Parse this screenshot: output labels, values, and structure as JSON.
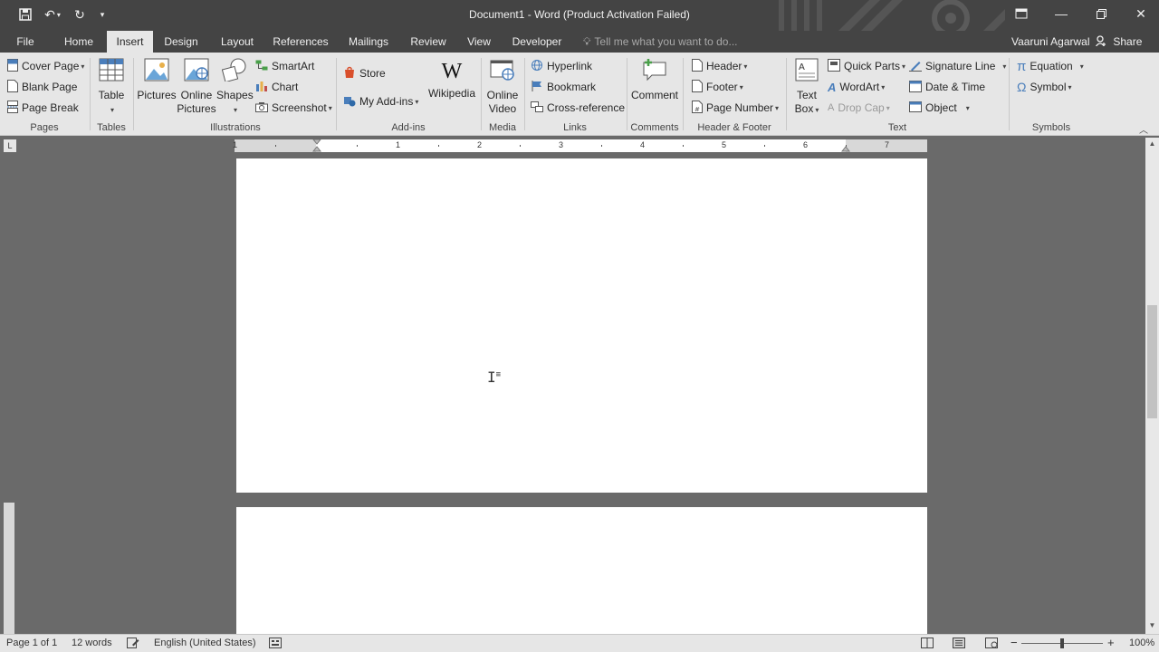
{
  "window": {
    "title": "Document1 - Word (Product Activation Failed)",
    "controls": [
      "ribbon-display-icon",
      "minimize-icon",
      "restore-icon",
      "close-icon"
    ]
  },
  "quick_access": {
    "icons": [
      "save-icon",
      "undo-icon",
      "redo-icon",
      "customize-icon"
    ]
  },
  "tabs": [
    {
      "label": "File"
    },
    {
      "label": "Home"
    },
    {
      "label": "Insert",
      "active": true
    },
    {
      "label": "Design"
    },
    {
      "label": "Layout"
    },
    {
      "label": "References"
    },
    {
      "label": "Mailings"
    },
    {
      "label": "Review"
    },
    {
      "label": "View"
    },
    {
      "label": "Developer"
    }
  ],
  "tell_me": "Tell me what you want to do...",
  "user": "Vaaruni Agarwal",
  "share": "Share",
  "ribbon": {
    "pages": {
      "label": "Pages",
      "items": [
        "Cover Page",
        "Blank Page",
        "Page Break"
      ]
    },
    "tables": {
      "label": "Tables",
      "table": "Table"
    },
    "illustrations": {
      "label": "Illustrations",
      "pictures": "Pictures",
      "online_pictures_1": "Online",
      "online_pictures_2": "Pictures",
      "shapes": "Shapes",
      "smartart": "SmartArt",
      "chart": "Chart",
      "screenshot": "Screenshot"
    },
    "addins": {
      "label": "Add-ins",
      "store": "Store",
      "my_addins": "My Add-ins",
      "wikipedia": "Wikipedia"
    },
    "media": {
      "label": "Media",
      "online_video_1": "Online",
      "online_video_2": "Video"
    },
    "links": {
      "label": "Links",
      "hyperlink": "Hyperlink",
      "bookmark": "Bookmark",
      "cross_reference": "Cross-reference"
    },
    "comments": {
      "label": "Comments",
      "comment": "Comment"
    },
    "header_footer": {
      "label": "Header & Footer",
      "header": "Header",
      "footer": "Footer",
      "page_number": "Page Number"
    },
    "text": {
      "label": "Text",
      "text_box_1": "Text",
      "text_box_2": "Box",
      "quick_parts": "Quick Parts",
      "wordart": "WordArt",
      "drop_cap": "Drop Cap",
      "signature_line": "Signature Line",
      "date_time": "Date & Time",
      "object": "Object"
    },
    "symbols": {
      "label": "Symbols",
      "equation": "Equation",
      "symbol": "Symbol"
    }
  },
  "ruler": {
    "numbers": [
      "1",
      "1",
      "2",
      "3",
      "4",
      "5",
      "6",
      "7"
    ]
  },
  "status": {
    "page": "Page 1 of 1",
    "words": "12 words",
    "language": "English (United States)",
    "zoom": "100%",
    "zoom_level": 1.0
  }
}
